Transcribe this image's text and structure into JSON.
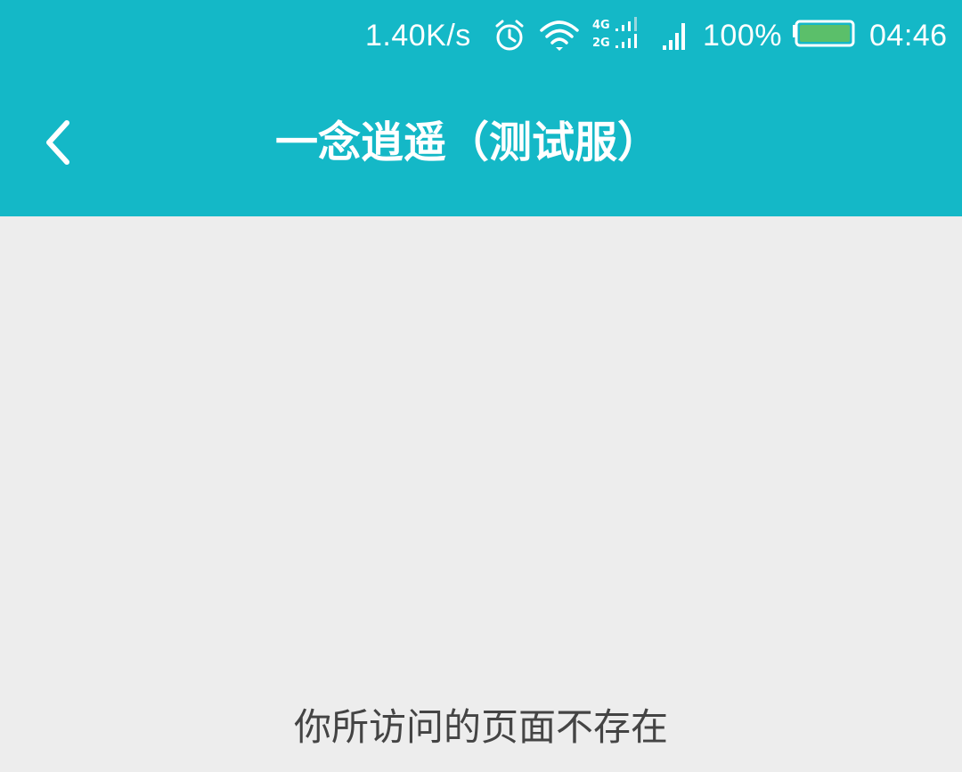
{
  "status_bar": {
    "net_speed": "1.40K/s",
    "network_type_top": "4G",
    "network_type_bottom": "2G",
    "battery_percent": "100%",
    "time": "04:46",
    "icons": [
      "alarm-icon",
      "wifi-icon",
      "dual-signal-icon",
      "cell-signal-icon",
      "battery-icon"
    ],
    "battery_level": 1.0
  },
  "nav": {
    "back_icon": "chevron-left-icon",
    "title": "一念逍遥（测试服）"
  },
  "content": {
    "message": "你所访问的页面不存在"
  },
  "colors": {
    "header_bg": "#14b8c7",
    "page_bg": "#ededed",
    "battery_fill": "#5bbf6a",
    "message_text": "#444444"
  }
}
